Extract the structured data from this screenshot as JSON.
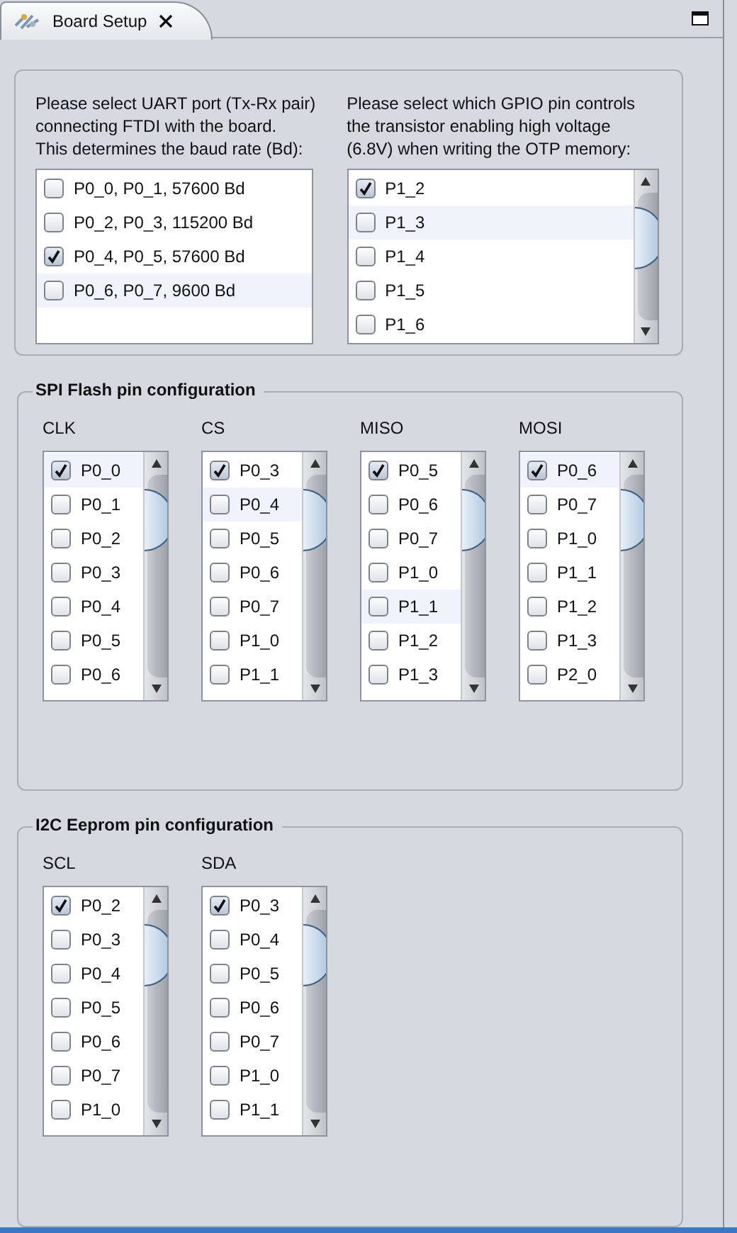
{
  "tab": {
    "title": "Board Setup"
  },
  "uart": {
    "prompt": "Please select UART port (Tx-Rx pair)\nconnecting FTDI with the board.\nThis determines the baud rate (Bd):",
    "options": [
      {
        "label": "P0_0, P0_1, 57600 Bd",
        "checked": false,
        "highlighted": false
      },
      {
        "label": "P0_2, P0_3, 115200 Bd",
        "checked": false,
        "highlighted": false
      },
      {
        "label": "P0_4, P0_5, 57600 Bd",
        "checked": true,
        "highlighted": false
      },
      {
        "label": "P0_6, P0_7, 9600 Bd",
        "checked": false,
        "highlighted": true
      }
    ]
  },
  "gpio": {
    "prompt": "Please select which GPIO pin controls\nthe transistor enabling high voltage\n(6.8V) when writing the OTP memory:",
    "options": [
      {
        "label": "P1_2",
        "checked": true,
        "highlighted": false
      },
      {
        "label": "P1_3",
        "checked": false,
        "highlighted": true
      },
      {
        "label": "P1_4",
        "checked": false,
        "highlighted": false
      },
      {
        "label": "P1_5",
        "checked": false,
        "highlighted": false
      },
      {
        "label": "P1_6",
        "checked": false,
        "highlighted": false
      }
    ]
  },
  "groups": [
    {
      "title": "SPI Flash pin configuration",
      "columns": [
        {
          "label": "CLK",
          "options": [
            {
              "label": "P0_0",
              "checked": true,
              "highlighted": true
            },
            {
              "label": "P0_1",
              "checked": false,
              "highlighted": false
            },
            {
              "label": "P0_2",
              "checked": false,
              "highlighted": false
            },
            {
              "label": "P0_3",
              "checked": false,
              "highlighted": false
            },
            {
              "label": "P0_4",
              "checked": false,
              "highlighted": false
            },
            {
              "label": "P0_5",
              "checked": false,
              "highlighted": false
            },
            {
              "label": "P0_6",
              "checked": false,
              "highlighted": false
            }
          ]
        },
        {
          "label": "CS",
          "options": [
            {
              "label": "P0_3",
              "checked": true,
              "highlighted": false
            },
            {
              "label": "P0_4",
              "checked": false,
              "highlighted": true
            },
            {
              "label": "P0_5",
              "checked": false,
              "highlighted": false
            },
            {
              "label": "P0_6",
              "checked": false,
              "highlighted": false
            },
            {
              "label": "P0_7",
              "checked": false,
              "highlighted": false
            },
            {
              "label": "P1_0",
              "checked": false,
              "highlighted": false
            },
            {
              "label": "P1_1",
              "checked": false,
              "highlighted": false
            }
          ]
        },
        {
          "label": "MISO",
          "options": [
            {
              "label": "P0_5",
              "checked": true,
              "highlighted": false
            },
            {
              "label": "P0_6",
              "checked": false,
              "highlighted": false
            },
            {
              "label": "P0_7",
              "checked": false,
              "highlighted": false
            },
            {
              "label": "P1_0",
              "checked": false,
              "highlighted": false
            },
            {
              "label": "P1_1",
              "checked": false,
              "highlighted": true
            },
            {
              "label": "P1_2",
              "checked": false,
              "highlighted": false
            },
            {
              "label": "P1_3",
              "checked": false,
              "highlighted": false
            }
          ]
        },
        {
          "label": "MOSI",
          "options": [
            {
              "label": "P0_6",
              "checked": true,
              "highlighted": true
            },
            {
              "label": "P0_7",
              "checked": false,
              "highlighted": false
            },
            {
              "label": "P1_0",
              "checked": false,
              "highlighted": false
            },
            {
              "label": "P1_1",
              "checked": false,
              "highlighted": false
            },
            {
              "label": "P1_2",
              "checked": false,
              "highlighted": false
            },
            {
              "label": "P1_3",
              "checked": false,
              "highlighted": false
            },
            {
              "label": "P2_0",
              "checked": false,
              "highlighted": false
            }
          ]
        }
      ]
    },
    {
      "title": "I2C Eeprom pin configuration",
      "columns": [
        {
          "label": "SCL",
          "options": [
            {
              "label": "P0_2",
              "checked": true,
              "highlighted": false
            },
            {
              "label": "P0_3",
              "checked": false,
              "highlighted": false
            },
            {
              "label": "P0_4",
              "checked": false,
              "highlighted": false
            },
            {
              "label": "P0_5",
              "checked": false,
              "highlighted": false
            },
            {
              "label": "P0_6",
              "checked": false,
              "highlighted": false
            },
            {
              "label": "P0_7",
              "checked": false,
              "highlighted": false
            },
            {
              "label": "P1_0",
              "checked": false,
              "highlighted": false
            }
          ]
        },
        {
          "label": "SDA",
          "options": [
            {
              "label": "P0_3",
              "checked": true,
              "highlighted": false
            },
            {
              "label": "P0_4",
              "checked": false,
              "highlighted": false
            },
            {
              "label": "P0_5",
              "checked": false,
              "highlighted": false
            },
            {
              "label": "P0_6",
              "checked": false,
              "highlighted": false
            },
            {
              "label": "P0_7",
              "checked": false,
              "highlighted": false
            },
            {
              "label": "P1_0",
              "checked": false,
              "highlighted": false
            },
            {
              "label": "P1_1",
              "checked": false,
              "highlighted": false
            }
          ]
        }
      ]
    }
  ]
}
